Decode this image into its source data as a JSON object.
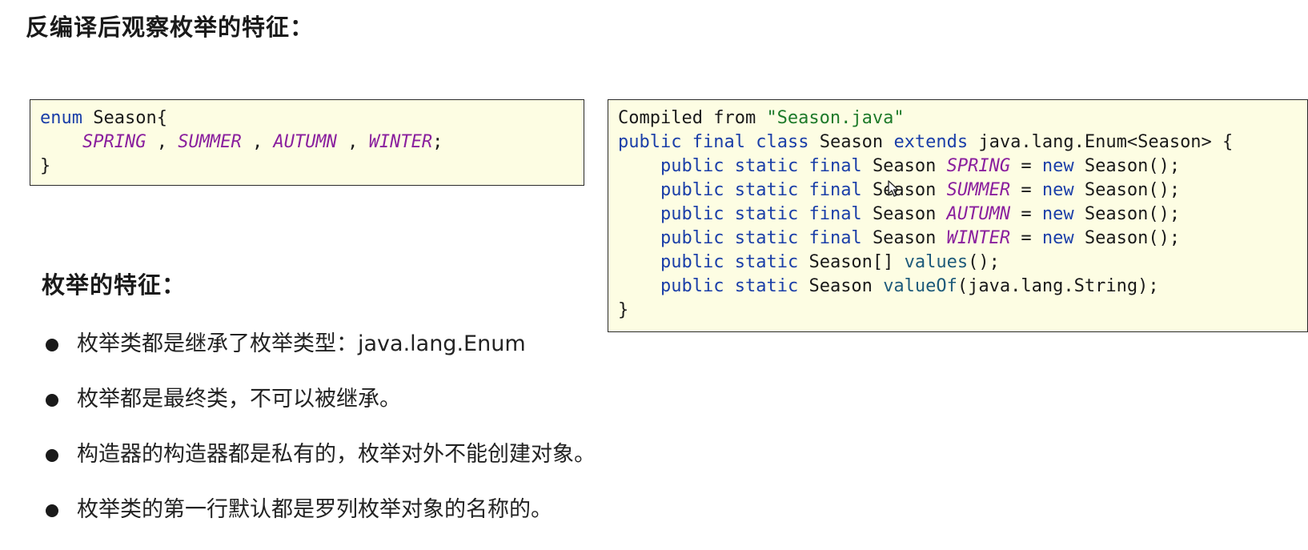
{
  "heading": "反编译后观察枚举的特征：",
  "left_code": {
    "line1": {
      "kw": "enum",
      "rest": " Season{"
    },
    "line2": {
      "indent": "    ",
      "c1": "SPRING",
      "sep1": " , ",
      "c2": "SUMMER",
      "sep2": " , ",
      "c3": "AUTUMN",
      "sep3": " , ",
      "c4": "WINTER",
      "end": ";"
    },
    "line3": "}"
  },
  "right_code": {
    "line1": {
      "prefix": "Compiled from ",
      "str": "\"Season.java\""
    },
    "line2": {
      "kw1": "public",
      "kw2": "final",
      "kw3": "class",
      "name": "Season",
      "kw4": "extends",
      "rest": "java.lang.Enum<Season> {"
    },
    "fields": [
      {
        "type": "Season",
        "const": "SPRING",
        "new_kw": "new",
        "ctor": "Season();"
      },
      {
        "type": "Season",
        "const": "SUMMER",
        "new_kw": "new",
        "ctor": "Season();"
      },
      {
        "type": "Season",
        "const": "AUTUMN",
        "new_kw": "new",
        "ctor": "Season();"
      },
      {
        "type": "Season",
        "const": "WINTER",
        "new_kw": "new",
        "ctor": "Season();"
      }
    ],
    "field_kw": {
      "public": "public",
      "static": "static",
      "final": "final"
    },
    "values_line": {
      "type": "Season[]",
      "method": "values",
      "rest": "();"
    },
    "valueof_line": {
      "type": "Season",
      "method": "valueOf",
      "rest": "(java.lang.String);"
    },
    "close": "}"
  },
  "sub_heading": "枚举的特征：",
  "features": [
    "枚举类都是继承了枚举类型：java.lang.Enum",
    "枚举都是最终类，不可以被继承。",
    "构造器的构造器都是私有的，枚举对外不能创建对象。",
    "枚举类的第一行默认都是罗列枚举对象的名称的。"
  ],
  "icons": {
    "cursor": "mouse-cursor-icon",
    "bullet": "bullet-dot-icon"
  },
  "colors": {
    "code_bg": "#fdfde3",
    "keyword": "#1a3ea8",
    "string": "#1e7a2a",
    "constant": "#8a1f9e"
  }
}
